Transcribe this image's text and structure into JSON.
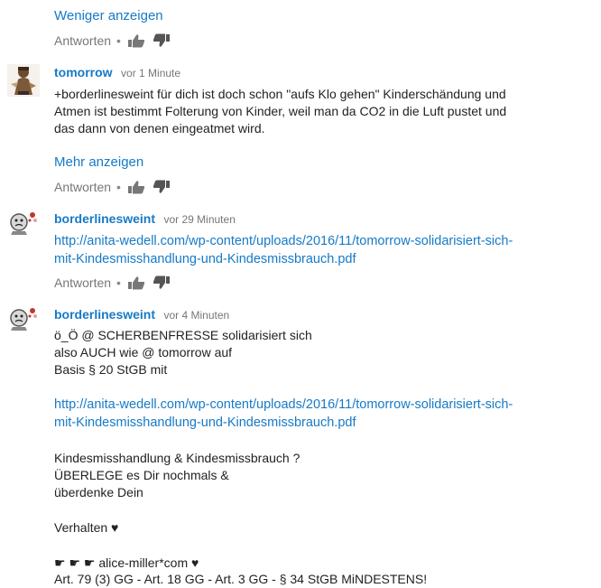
{
  "common": {
    "reply_label": "Antworten",
    "separator": "•",
    "like_icon": "thumbs-up-icon",
    "dislike_icon": "thumbs-down-icon"
  },
  "top": {
    "show_less": "Weniger anzeigen"
  },
  "comments": [
    {
      "author": "tomorrow",
      "time": "vor 1 Minute",
      "lines": [
        "+borderlinesweint für dich ist doch schon \"aufs Klo gehen\" Kinderschändung und",
        "Atmen ist bestimmt Folterung von Kinder, weil man da CO2 in die Luft pustet und",
        "das dann von denen eingeatmet wird."
      ],
      "show_more": "Mehr anzeigen"
    },
    {
      "author": "borderlinesweint",
      "time": "vor 29 Minuten",
      "url_lines": [
        "http://anita-wedell.com/wp-content/uploads/2016/11/tomorrow-solidarisiert-sich-",
        "mit-Kindesmisshandlung-und-Kindesmissbrauch.pdf"
      ]
    },
    {
      "author": "borderlinesweint",
      "time": "vor 4 Minuten",
      "lines_a": [
        "ö_Ö @ SCHERBENFRESSE solidarisiert sich",
        "also AUCH wie @ tomorrow auf",
        "Basis § 20 StGB mit"
      ],
      "url_lines": [
        "http://anita-wedell.com/wp-content/uploads/2016/11/tomorrow-solidarisiert-sich-",
        "mit-Kindesmisshandlung-und-Kindesmissbrauch.pdf"
      ],
      "lines_b": [
        "Kindesmisshandlung & Kindesmissbrauch ?",
        "ÜBERLEGE es Dir nochmals &",
        "überdenke Dein"
      ],
      "line_c": "Verhalten  ♥",
      "line_d": "☛ ☛ ☛ alice-miller*com ♥",
      "line_e": "Art. 79 (3) GG - Art. 18 GG - Art. 3 GG - § 34 StGB MiNDESTENS!"
    }
  ]
}
